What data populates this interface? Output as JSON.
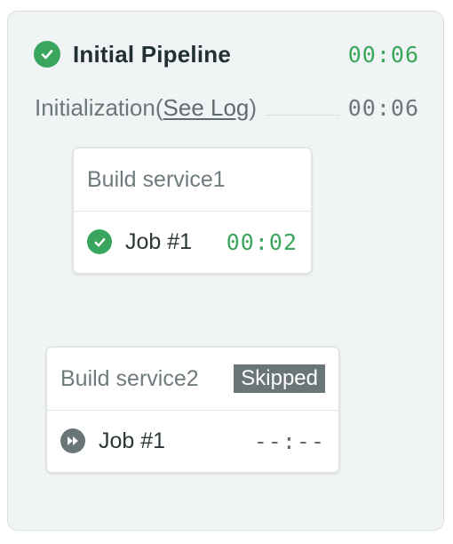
{
  "pipeline": {
    "title": "Initial Pipeline",
    "duration": "00:06",
    "status": "passed"
  },
  "initialization": {
    "label": "Initialization",
    "open_paren": "(",
    "link_label": "See Log",
    "close_paren": ")",
    "duration": "00:06"
  },
  "blocks": [
    {
      "title": "Build service1",
      "badge": "",
      "job": {
        "name": "Job #1",
        "duration": "00:02",
        "status": "passed",
        "icon": "check-circle-icon"
      }
    },
    {
      "title": "Build service2",
      "badge": "Skipped",
      "job": {
        "name": "Job #1",
        "duration": "--:--",
        "status": "skipped",
        "icon": "skip-forward-icon"
      }
    }
  ],
  "colors": {
    "passed": "#3aa65d",
    "skipped": "#5f6b6e",
    "panel_bg": "#f1f4f5"
  }
}
